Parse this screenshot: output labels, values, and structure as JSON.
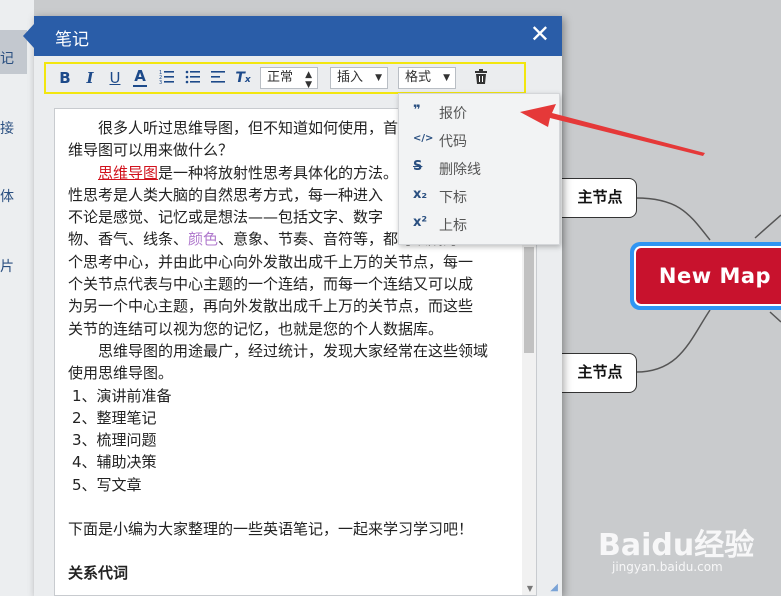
{
  "background": {
    "left_strip": [
      "记",
      "接",
      "体",
      "片"
    ],
    "nodes": {
      "top_branch": "主节点",
      "bottom_branch": "主节点",
      "center": "New Map"
    },
    "watermark": {
      "brand": "Baidu经验",
      "url": "jingyan.baidu.com"
    }
  },
  "dialog": {
    "title": "笔记",
    "close_icon": "close-icon"
  },
  "toolbar": {
    "bold": "B",
    "italic": "I",
    "underline": "U",
    "font_color": "A",
    "paragraph_style": "正常",
    "insert_menu": "插入",
    "format_menu": "格式"
  },
  "editor": {
    "p1": "很多人听过思维导图，但不知道如何使用，首先给友就问，思维导图可以用来做什么？",
    "p2_link": "思维导图",
    "p2_a": "是一种将放射性思考具体化的方法。",
    "p2_b": "性思考是人类大脑的自然思考方式，每一种进入",
    "p2_c": "不论是感觉、记忆或是想法——包括文字、数字",
    "p2_d_a": "物、香气、线条、",
    "p2_d_color": "颜色",
    "p2_d_b": "、意象、节奏、音符等，都可以成为",
    "p2_e": "个思考中心，并由此中心向外发散出成千上万的关节点，每一",
    "p2_f": "个关节点代表与中心主题的一个连结，而每一个连结又可以成",
    "p2_g": "为另一个中心主题，再向外发散出成千上万的关节点，而这些",
    "p2_h": "关节的连结可以视为您的记忆，也就是您的个人数据库。",
    "p3_a": "思维导图的用途最广，经过统计，发现大家经常在这些领域",
    "p3_b": "使用思维导图。",
    "list": [
      "1、演讲前准备",
      "2、整理笔记",
      "3、梳理问题",
      "4、辅助决策",
      "5、写文章"
    ],
    "p4": "下面是小编为大家整理的一些英语笔记，一起来学习学习吧！",
    "p5": "关系代词"
  },
  "format_dropdown": {
    "items": [
      {
        "icon": "quote-icon",
        "glyph": "❞",
        "label": "报价"
      },
      {
        "icon": "code-icon",
        "glyph": "</>",
        "label": "代码"
      },
      {
        "icon": "strikethrough-icon",
        "glyph": "S",
        "label": "删除线"
      },
      {
        "icon": "subscript-icon",
        "glyph": "x₂",
        "label": "下标"
      },
      {
        "icon": "superscript-icon",
        "glyph": "x²",
        "label": "上标"
      }
    ]
  },
  "colors": {
    "titlebar": "#2a5da8",
    "toolbar_highlight": "#f2e60f",
    "center_node": "#c8122d",
    "center_border": "#2f95f3",
    "arrow": "#e53939"
  }
}
